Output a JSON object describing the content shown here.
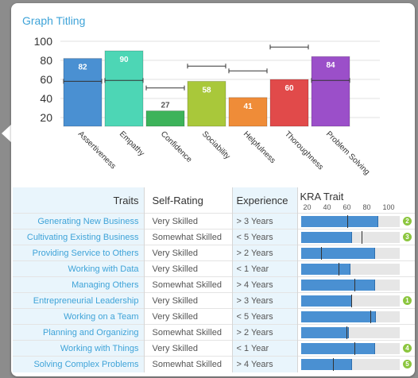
{
  "chart_data": {
    "type": "bar",
    "title": "Graph Titling",
    "categories": [
      "Assertiveness",
      "Empathy",
      "Confidence",
      "Sociability",
      "Helpfulness",
      "Thoroughness",
      "Problem Solving"
    ],
    "values": [
      82,
      90,
      27,
      58,
      41,
      60,
      84
    ],
    "targets": [
      58,
      59,
      51,
      74,
      69,
      94,
      59
    ],
    "colors": [
      "#4a90d2",
      "#4dd6b5",
      "#3db35a",
      "#a9c83a",
      "#ef8c38",
      "#e14a4a",
      "#9b4fc9"
    ],
    "yticks": [
      "100",
      "80",
      "60",
      "40",
      "20"
    ],
    "ylim": [
      0,
      100
    ],
    "grid": true
  },
  "table": {
    "headers": {
      "traits": "Traits",
      "self": "Self-Rating",
      "experience": "Experience",
      "kra": "KRA Trait"
    },
    "kra_ticks": [
      "20",
      "40",
      "60",
      "80",
      "100"
    ],
    "rows": [
      {
        "trait": "Generating New Business",
        "self": "Very Skilled",
        "exp": "> 3 Years",
        "kra": 78,
        "target": 47,
        "badge": "2"
      },
      {
        "trait": "Cultivating Existing Business",
        "self": "Somewhat Skilled",
        "exp": "< 5 Years",
        "kra": 52,
        "target": 61,
        "badge": "3"
      },
      {
        "trait": "Providing Service to Others",
        "self": "Very Skilled",
        "exp": "> 2 Years",
        "kra": 75,
        "target": 20,
        "badge": ""
      },
      {
        "trait": "Working with Data",
        "self": "Very Skilled",
        "exp": "< 1 Year",
        "kra": 50,
        "target": 38,
        "badge": ""
      },
      {
        "trait": "Managing Others",
        "self": "Somewhat Skilled",
        "exp": "> 4 Years",
        "kra": 75,
        "target": 54,
        "badge": ""
      },
      {
        "trait": "Entrepreneurial Leadership",
        "self": "Very Skilled",
        "exp": "> 3 Years",
        "kra": 52,
        "target": 51,
        "badge": "1"
      },
      {
        "trait": "Working on a Team",
        "self": "Very Skilled",
        "exp": "< 5 Years",
        "kra": 76,
        "target": 70,
        "badge": ""
      },
      {
        "trait": "Planning and Organizing",
        "self": "Somewhat Skilled",
        "exp": "> 2 Years",
        "kra": 48,
        "target": 46,
        "badge": ""
      },
      {
        "trait": "Working with Things",
        "self": "Very Skilled",
        "exp": "< 1 Year",
        "kra": 75,
        "target": 54,
        "badge": "4"
      },
      {
        "trait": "Solving Complex Problems",
        "self": "Somewhat Skilled",
        "exp": "> 4 Years",
        "kra": 52,
        "target": 32,
        "badge": "5"
      }
    ]
  }
}
